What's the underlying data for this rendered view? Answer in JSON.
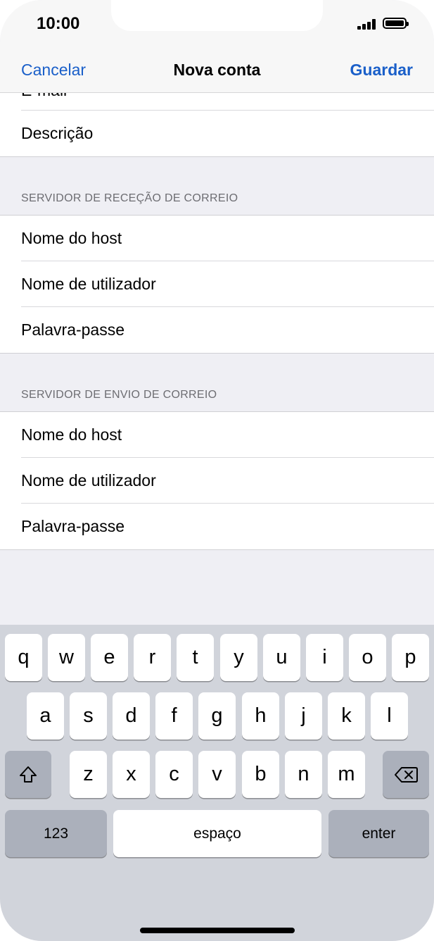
{
  "status_bar": {
    "time": "10:00"
  },
  "nav": {
    "cancel_label": "Cancelar",
    "title": "Nova conta",
    "save_label": "Guardar"
  },
  "form": {
    "partial_row_label": "E-mail",
    "description_label": "Descrição",
    "incoming": {
      "header": "SERVIDOR DE RECEÇÃO DE CORREIO",
      "rows": [
        "Nome do host",
        "Nome de utilizador",
        "Palavra-passe"
      ]
    },
    "outgoing": {
      "header": "SERVIDOR DE ENVIO DE CORREIO",
      "rows": [
        "Nome do host",
        "Nome de utilizador",
        "Palavra-passe"
      ]
    }
  },
  "keyboard": {
    "row1": [
      "q",
      "w",
      "e",
      "r",
      "t",
      "y",
      "u",
      "i",
      "o",
      "p"
    ],
    "row2": [
      "a",
      "s",
      "d",
      "f",
      "g",
      "h",
      "j",
      "k",
      "l"
    ],
    "row3": [
      "z",
      "x",
      "c",
      "v",
      "b",
      "n",
      "m"
    ],
    "numbers_label": "123",
    "space_label": "espaço",
    "enter_label": "enter",
    "shift_icon": "shift-arrow-icon",
    "backspace_icon": "backspace-icon"
  },
  "colors": {
    "accent": "#1a5fc9",
    "group_background": "#efeff4",
    "keyboard_background": "#d1d4db",
    "dark_key": "#abb0bb"
  }
}
